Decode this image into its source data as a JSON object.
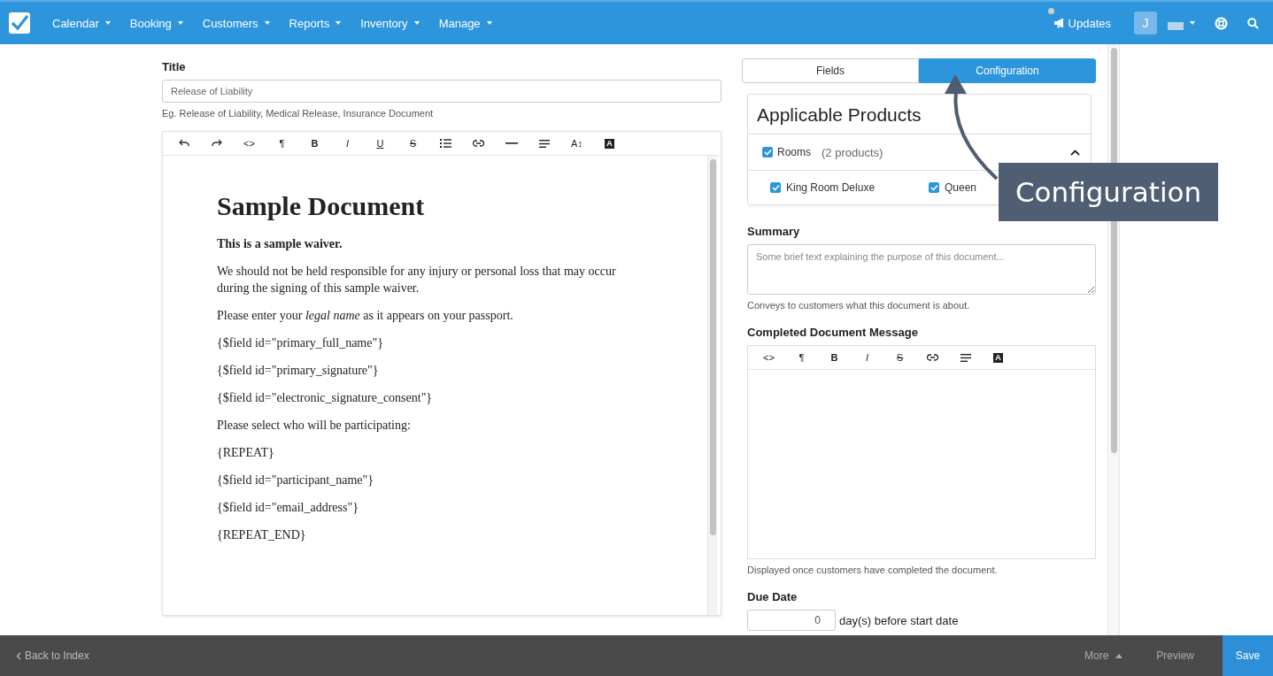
{
  "nav": {
    "menus": [
      "Calendar",
      "Booking",
      "Customers",
      "Reports",
      "Inventory",
      "Manage"
    ],
    "updates": "Updates",
    "updates_unread": true,
    "avatar": "J"
  },
  "title_field": {
    "label": "Title",
    "placeholder": "Release of Liability",
    "hint": "Eg. Release of Liability, Medical Release, Insurance Document"
  },
  "editor": {
    "toolbar": [
      {
        "kind": "undo"
      },
      {
        "kind": "redo"
      },
      {
        "kind": "code",
        "glyph": "<>"
      },
      {
        "kind": "paragraph",
        "glyph": "¶"
      },
      {
        "kind": "bold",
        "glyph": "B"
      },
      {
        "kind": "italic",
        "glyph": "I"
      },
      {
        "kind": "underline",
        "glyph": "U"
      },
      {
        "kind": "strike",
        "glyph": "S"
      },
      {
        "kind": "list"
      },
      {
        "kind": "link"
      },
      {
        "kind": "rule"
      },
      {
        "kind": "align"
      },
      {
        "kind": "size",
        "glyph": "A↕"
      },
      {
        "kind": "color",
        "glyph": "A"
      }
    ],
    "heading": "Sample Document",
    "paragraphs": [
      {
        "kind": "bold",
        "text": "This is a sample waiver."
      },
      {
        "kind": "plain",
        "text": "We should not be held responsible for any injury or personal loss that may occur during the signing of this sample waiver."
      },
      {
        "kind": "plain",
        "text": "Please enter your *legal name* as it appears on your passport."
      },
      {
        "kind": "plain",
        "text": "{$field id=\"primary_full_name\"}"
      },
      {
        "kind": "plain",
        "text": "{$field id=\"primary_signature\"}"
      },
      {
        "kind": "plain",
        "text": "{$field id=\"electronic_signature_consent\"}"
      },
      {
        "kind": "plain",
        "text": "Please select who will be participating:"
      },
      {
        "kind": "plain",
        "text": "{REPEAT}"
      },
      {
        "kind": "plain",
        "text": "{$field id=\"participant_name\"}"
      },
      {
        "kind": "plain",
        "text": "{$field id=\"email_address\"}"
      },
      {
        "kind": "plain",
        "text": "{REPEAT_END}"
      }
    ]
  },
  "tabs": [
    {
      "label": "Fields",
      "selected": false
    },
    {
      "label": "Configuration",
      "selected": true
    }
  ],
  "products": {
    "title": "Applicable Products",
    "groups": [
      {
        "label": "Rooms",
        "count": "(2 products)",
        "checked": true,
        "expanded": true,
        "items": [
          {
            "label": "King Room Deluxe",
            "checked": true
          },
          {
            "label": "Queen",
            "checked": true
          }
        ]
      }
    ]
  },
  "summary": {
    "label": "Summary",
    "placeholder": "Some brief text explaining the purpose of this document...",
    "hint": "Conveys to customers what this document is about."
  },
  "message": {
    "label": "Completed Document Message",
    "toolbar": [
      {
        "kind": "code",
        "glyph": "<>"
      },
      {
        "kind": "paragraph",
        "glyph": "¶"
      },
      {
        "kind": "bold",
        "glyph": "B"
      },
      {
        "kind": "italic",
        "glyph": "I"
      },
      {
        "kind": "strike",
        "glyph": "S"
      },
      {
        "kind": "link"
      },
      {
        "kind": "align"
      },
      {
        "kind": "color",
        "glyph": "A"
      }
    ],
    "hint": "Displayed once customers have completed the document."
  },
  "due_date": {
    "label": "Due Date",
    "value": "0",
    "suffix": "day(s) before start date"
  },
  "callout": {
    "text": "Configuration"
  },
  "footer": {
    "back": "Back to Index",
    "more": "More",
    "preview": "Preview",
    "save": "Save"
  }
}
